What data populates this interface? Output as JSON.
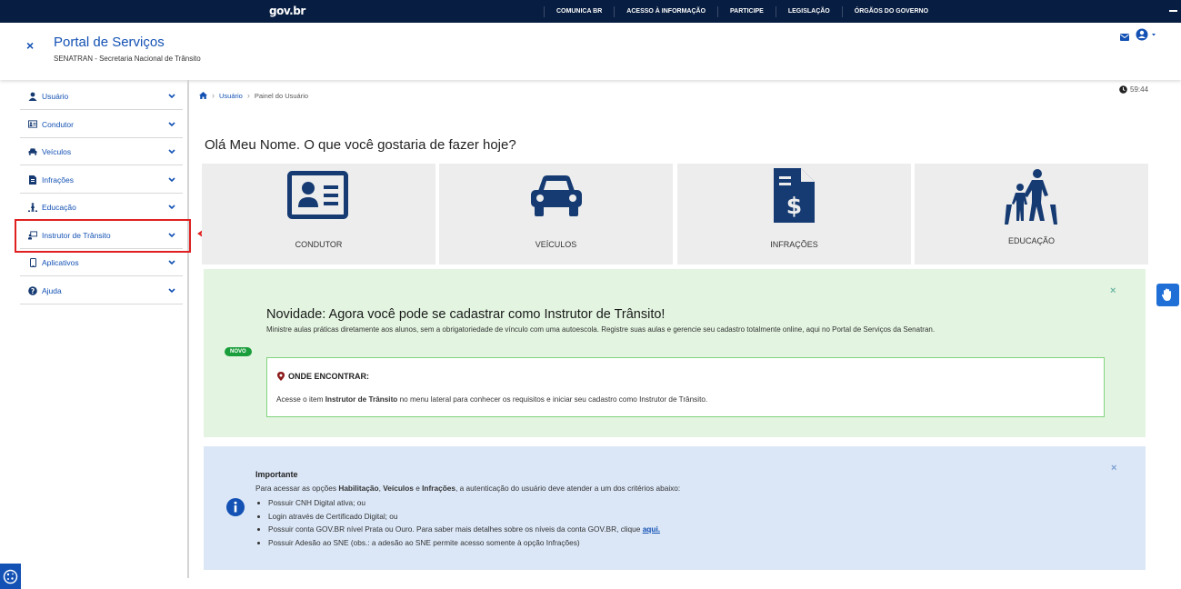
{
  "govbar": {
    "logo": "gov.br",
    "links": [
      "COMUNICA BR",
      "ACESSO À INFORMAÇÃO",
      "PARTICIPE",
      "LEGISLAÇÃO",
      "ÓRGÃOS DO GOVERNO"
    ]
  },
  "header": {
    "title": "Portal de Serviços",
    "subtitle": "SENATRAN - Secretaria Nacional de Trânsito",
    "close_glyph": "×"
  },
  "sidebar": {
    "items": [
      {
        "label": "Usuário",
        "icon": "user-icon"
      },
      {
        "label": "Condutor",
        "icon": "id-card-icon"
      },
      {
        "label": "Veículos",
        "icon": "car-icon"
      },
      {
        "label": "Infrações",
        "icon": "document-icon"
      },
      {
        "label": "Educação",
        "icon": "pedestrian-icon"
      },
      {
        "label": "Instrutor de Trânsito",
        "icon": "instructor-icon"
      },
      {
        "label": "Aplicativos",
        "icon": "mobile-icon"
      },
      {
        "label": "Ajuda",
        "icon": "question-icon"
      }
    ]
  },
  "breadcrumb": {
    "items": [
      "Usuário",
      "Painel do Usuário"
    ]
  },
  "timer": "59:44",
  "greeting": "Olá Meu Nome. O que você gostaria de fazer hoje?",
  "cards": [
    {
      "label": "CONDUTOR",
      "icon": "id-card-icon"
    },
    {
      "label": "VEÍCULOS",
      "icon": "car-icon"
    },
    {
      "label": "INFRAÇÕES",
      "icon": "invoice-dollar-icon"
    },
    {
      "label": "EDUCAÇÃO",
      "icon": "pedestrian-crossing-icon"
    }
  ],
  "novelty": {
    "badge": "NOVO",
    "title": "Novidade: Agora você pode se cadastrar como Instrutor de Trânsito!",
    "text": "Ministre aulas práticas diretamente aos alunos, sem a obrigatoriedade de vínculo com uma autoescola. Registre suas aulas e gerencie seu cadastro totalmente online, aqui no Portal de Serviços da Senatran.",
    "where_title": "ONDE ENCONTRAR:",
    "where_pre": "Acesse o item ",
    "where_bold": "Instrutor de Trânsito",
    "where_post": " no menu lateral para conhecer os requisitos e iniciar seu cadastro como Instrutor de Trânsito.",
    "close_glyph": "×"
  },
  "important": {
    "title": "Importante",
    "intro_pre": "Para acessar as opções ",
    "intro_b1": "Habilitação",
    "intro_sep1": ", ",
    "intro_b2": "Veículos",
    "intro_sep2": " e ",
    "intro_b3": "Infrações",
    "intro_post": ", a autenticação do usuário deve atender a um dos critérios abaixo:",
    "bullets": [
      "Possuir CNH Digital ativa; ou",
      "Login através de Certificado Digital; ou",
      "Possuir conta GOV.BR nível Prata ou Ouro. Para saber mais detalhes sobre os níveis da conta GOV.BR, clique ",
      "Possuir Adesão ao SNE (obs.: a adesão ao SNE permite acesso somente à opção Infrações)"
    ],
    "link_text": "aqui.",
    "close_glyph": "×"
  },
  "colors": {
    "govbar": "#071d41",
    "primary": "#1351b4",
    "icon_dark": "#163a72",
    "green_alert": "#e3f5e1",
    "blue_alert": "#dbe7f7",
    "highlight": "#e02020"
  }
}
